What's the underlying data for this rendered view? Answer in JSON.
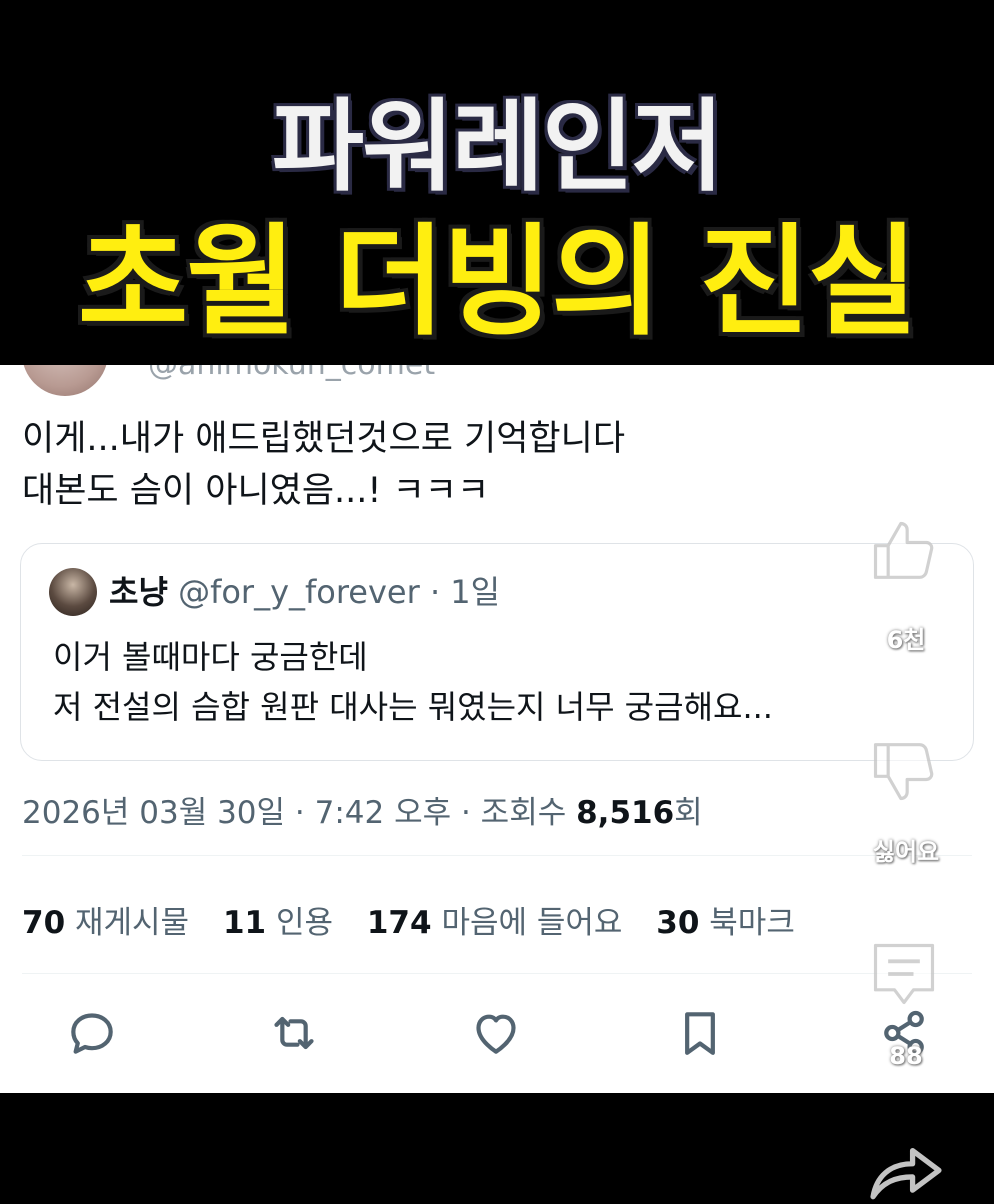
{
  "banner": {
    "line1": "파워레인저",
    "line2": "초월 더빙의 진실"
  },
  "tweet": {
    "handle_partial": "@animokun_comet",
    "text_line1": "이게...내가 애드립했던것으로 기억합니다",
    "text_line2": "대본도 슴이 아니였음...! ㅋㅋㅋ",
    "quote": {
      "name": "초냥",
      "handle": "@for_y_forever",
      "time": " · 1일",
      "line1": "이거 볼때마다 궁금한데",
      "line2": "저 전설의 슴합 원판 대사는 뭐였는지 너무 궁금해요..."
    },
    "meta": {
      "date": "2026년 03월 30일 · 7:42 오후 · 조회수 ",
      "views": "8,516",
      "views_suffix": "회"
    },
    "stats": {
      "retweets_count": "70",
      "retweets_label": "재게시물",
      "quotes_count": "11",
      "quotes_label": "인용",
      "likes_count": "174",
      "likes_label": "마음에 들어요",
      "bookmarks_count": "30",
      "bookmarks_label": "북마크"
    },
    "actions": [
      "reply-icon",
      "retweet-icon",
      "heart-icon",
      "bookmark-icon",
      "share-icon"
    ]
  },
  "overlay": {
    "like_count": "6천",
    "dislike_label": "싫어요",
    "share_count": "88"
  },
  "colors": {
    "banner_yellow": "#ffee10",
    "text_primary": "#0f1419",
    "text_secondary": "#536471"
  }
}
